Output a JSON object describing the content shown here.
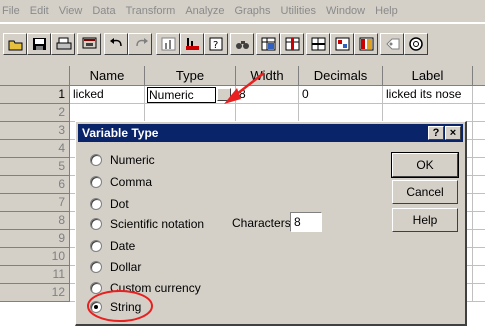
{
  "menubar": {
    "items": [
      "File",
      "Edit",
      "View",
      "Data",
      "Transform",
      "Analyze",
      "Graphs",
      "Utilities",
      "Window",
      "Help"
    ]
  },
  "toolbar": {
    "icons": [
      "open-icon",
      "save-icon",
      "print-icon",
      "dialog-recall-icon",
      "undo-icon",
      "redo-icon",
      "goto-chart-icon",
      "goto-case-icon",
      "variables-icon",
      "find-icon",
      "insert-cases-icon",
      "insert-variable-icon",
      "split-file-icon",
      "weight-cases-icon",
      "select-cases-icon",
      "value-labels-icon",
      "use-sets-icon"
    ]
  },
  "grid": {
    "columns": [
      "Name",
      "Type",
      "Width",
      "Decimals",
      "Label"
    ],
    "row_numbers": [
      "1",
      "2",
      "3",
      "4",
      "5",
      "6",
      "7",
      "8",
      "9",
      "10",
      "11",
      "12"
    ],
    "row1": {
      "name": "licked",
      "type": "Numeric",
      "width": "8",
      "decimals": "0",
      "label": "licked its nose"
    }
  },
  "dialog": {
    "title": "Variable Type",
    "help_btn": "?",
    "close_btn": "×",
    "options": [
      "Numeric",
      "Comma",
      "Dot",
      "Scientific notation",
      "Date",
      "Dollar",
      "Custom currency",
      "String"
    ],
    "selected": "String",
    "characters_label": "Characters:",
    "characters_value": "8",
    "ok": "OK",
    "cancel": "Cancel",
    "help": "Help"
  },
  "colors": {
    "annotation": "#e82020",
    "titlebar": "#0a246a",
    "chrome": "#d4d0c8"
  }
}
